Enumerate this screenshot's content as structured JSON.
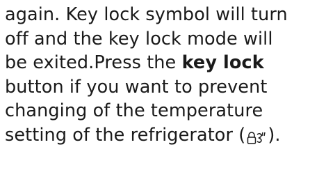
{
  "document": {
    "line1": "again. Key lock symbol will turn",
    "line2": "off and the key lock mode will",
    "line3_before": "be exited.Press the ",
    "line3_bold": "key lock",
    "line4": "button if you want to prevent",
    "line5": "changing of the temperature",
    "line6_before": "setting of the refrigerator (",
    "line6_after": ").",
    "symbol_icon": "key-lock-icon"
  }
}
